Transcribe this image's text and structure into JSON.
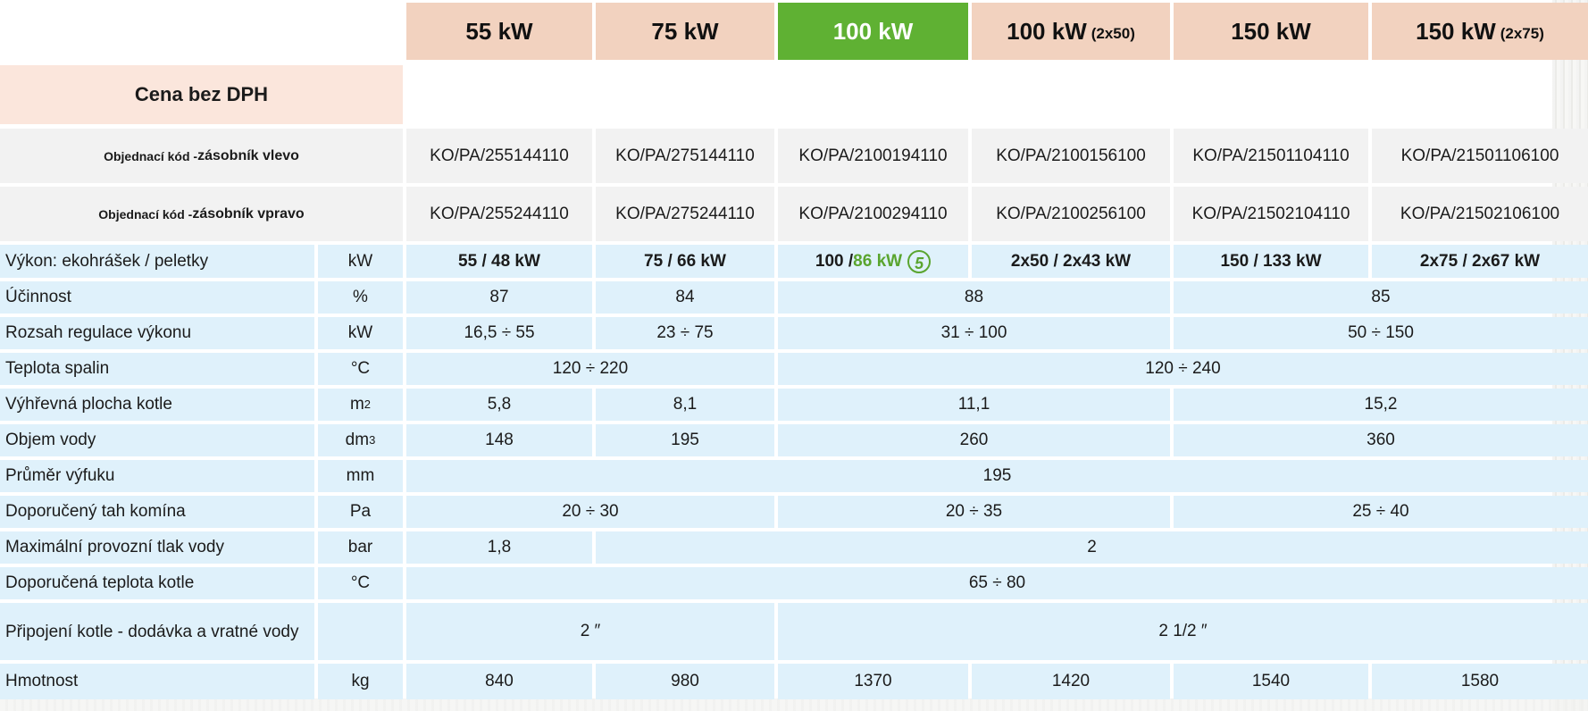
{
  "models": [
    {
      "main": "55 kW",
      "suffix": ""
    },
    {
      "main": "75 kW",
      "suffix": ""
    },
    {
      "main": "100 kW",
      "suffix": ""
    },
    {
      "main": "100 kW",
      "suffix": "(2x50)"
    },
    {
      "main": "150 kW",
      "suffix": ""
    },
    {
      "main": "150 kW",
      "suffix": "(2x75)"
    }
  ],
  "price_label": "Cena bez DPH",
  "order_left": {
    "label_plain": "Objednací kód - ",
    "label_bold": "zásobník vlevo",
    "codes": [
      "KO/PA/255144110",
      "KO/PA/275144110",
      "KO/PA/2100194110",
      "KO/PA/2100156100",
      "KO/PA/21501104110",
      "KO/PA/21501106100"
    ]
  },
  "order_right": {
    "label_plain": "Objednací kód - ",
    "label_bold": "zásobník vpravo",
    "codes": [
      "KO/PA/255244110",
      "KO/PA/275244110",
      "KO/PA/2100294110",
      "KO/PA/2100256100",
      "KO/PA/21502104110",
      "KO/PA/21502106100"
    ]
  },
  "power": {
    "label": "Výkon: ekohrášek / peletky",
    "unit": "kW",
    "values": [
      "55 / 48 kW",
      "75 / 66 kW",
      "100 / ",
      "2x50 / 2x43 kW",
      "150 / 133 kW",
      "2x75 / 2x67 kW"
    ],
    "highlight": "86 kW",
    "badge": "5"
  },
  "efficiency": {
    "label": "Účinnost",
    "unit": "%",
    "values": [
      "87",
      "84",
      "88",
      "85"
    ]
  },
  "regulation": {
    "label": "Rozsah regulace výkonu",
    "unit": "kW",
    "values": [
      "16,5 ÷ 55",
      "23 ÷ 75",
      "31 ÷ 100",
      "50 ÷ 150"
    ]
  },
  "flue_temp": {
    "label": "Teplota spalin",
    "unit": "°C",
    "values": [
      "120 ÷ 220",
      "120 ÷ 240"
    ]
  },
  "heating_surface": {
    "label": "Výhřevná plocha kotle",
    "unit_base": "m",
    "unit_sup": "2",
    "values": [
      "5,8",
      "8,1",
      "11,1",
      "15,2"
    ]
  },
  "water_volume": {
    "label": "Objem vody",
    "unit_base": "dm",
    "unit_sup": "3",
    "values": [
      "148",
      "195",
      "260",
      "360"
    ]
  },
  "exhaust_diameter": {
    "label": "Průměr výfuku",
    "unit": "mm",
    "values": [
      "195"
    ]
  },
  "chimney_draft": {
    "label": "Doporučený tah komína",
    "unit": "Pa",
    "values": [
      "20 ÷ 30",
      "20 ÷ 35",
      "25 ÷ 40"
    ]
  },
  "max_pressure": {
    "label": "Maximální provozní tlak vody",
    "unit": "bar",
    "values": [
      "1,8",
      "2"
    ]
  },
  "boiler_temp": {
    "label": "Doporučená teplota kotle",
    "unit": "°C",
    "values": [
      "65 ÷ 80"
    ]
  },
  "connection": {
    "label": "Připojení kotle - dodávka a vratné vody",
    "unit": "",
    "values": [
      "2 ″",
      "2 1/2 ″"
    ]
  },
  "weight": {
    "label": "Hmotnost",
    "unit": "kg",
    "values": [
      "840",
      "980",
      "1370",
      "1420",
      "1540",
      "1580"
    ]
  }
}
